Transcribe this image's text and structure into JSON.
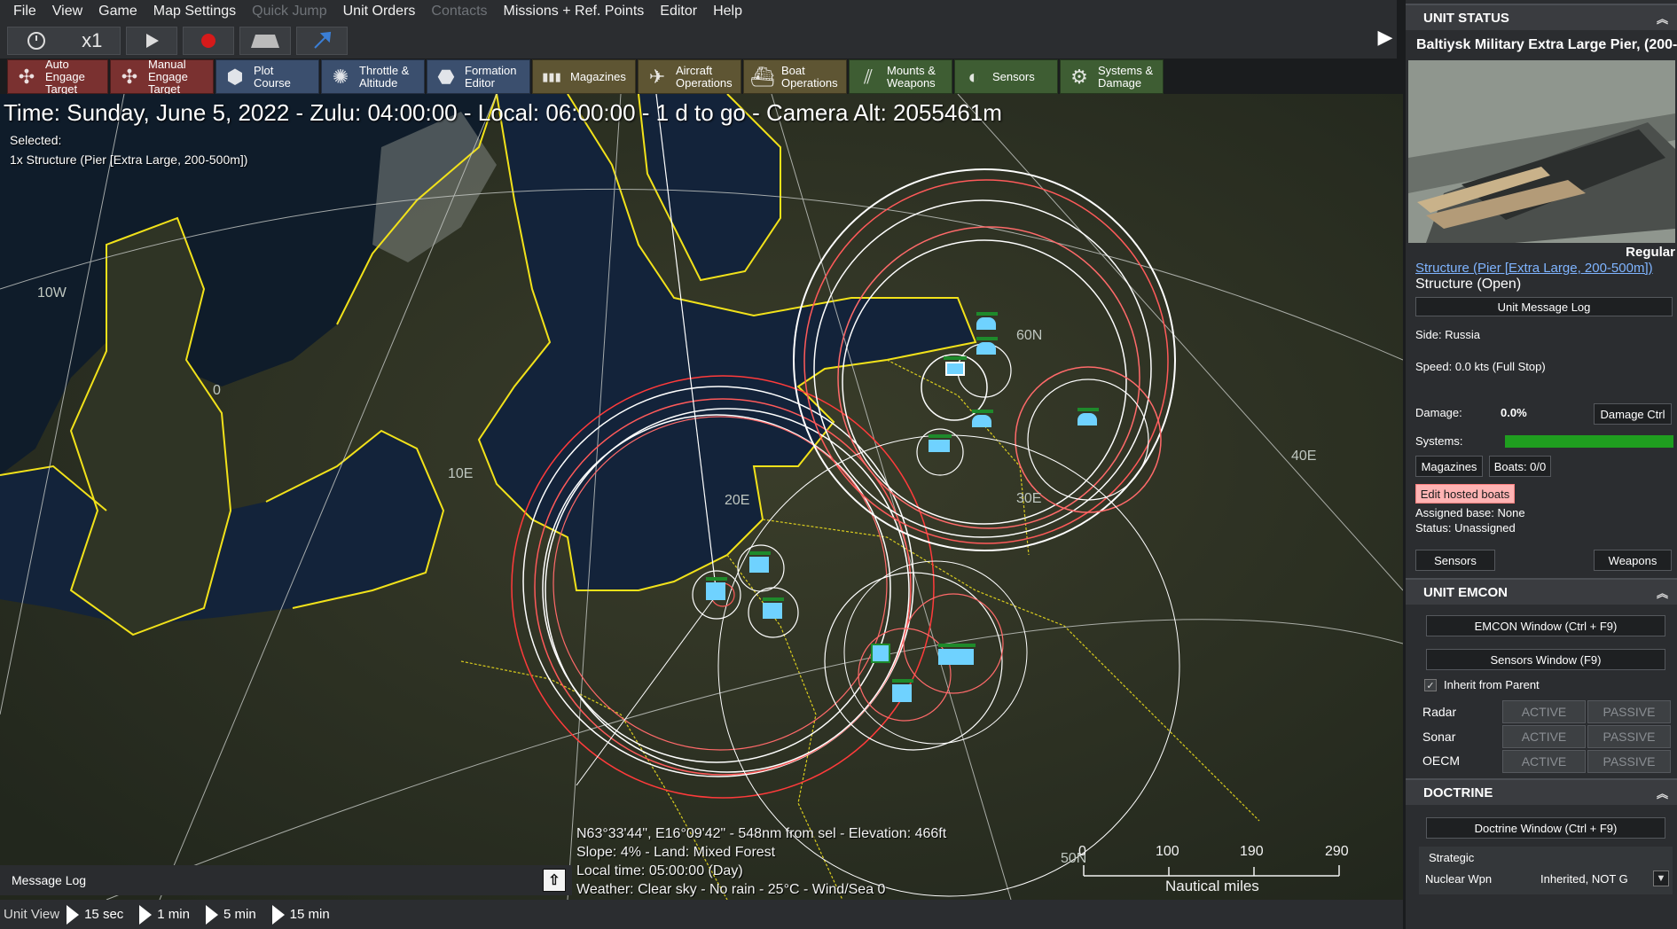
{
  "menu": [
    "File",
    "View",
    "Game",
    "Map Settings",
    "Quick Jump",
    "Unit Orders",
    "Contacts",
    "Missions + Ref. Points",
    "Editor",
    "Help"
  ],
  "menu_disabled": [
    "Quick Jump",
    "Contacts"
  ],
  "controls": {
    "speed": "x1",
    "icons": [
      "clock-icon",
      "play-icon",
      "record-icon",
      "hud-icon",
      "jump-icon"
    ]
  },
  "toolbar": [
    {
      "label": "Auto Engage\nTarget",
      "icon": "auto-engage-icon",
      "color": "#7a3130"
    },
    {
      "label": "Manual\nEngage Target",
      "icon": "manual-engage-icon",
      "color": "#7a3130"
    },
    {
      "label": "Plot Course",
      "icon": "plot-course-icon",
      "color": "#3b4f6e"
    },
    {
      "label": "Throttle &\nAltitude",
      "icon": "throttle-icon",
      "color": "#3b4f6e"
    },
    {
      "label": "Formation\nEditor",
      "icon": "formation-icon",
      "color": "#3b4f6e"
    },
    {
      "label": "Magazines",
      "icon": "magazines-icon",
      "color": "#5e5533"
    },
    {
      "label": "Aircraft\nOperations",
      "icon": "aircraft-icon",
      "color": "#5e5533"
    },
    {
      "label": "Boat\nOperations",
      "icon": "boat-icon",
      "color": "#5e5533"
    },
    {
      "label": "Mounts &\nWeapons",
      "icon": "mounts-icon",
      "color": "#3e5d33"
    },
    {
      "label": "Sensors",
      "icon": "sensors-icon",
      "color": "#3e5d33"
    },
    {
      "label": "Systems &\nDamage",
      "icon": "systems-icon",
      "color": "#3e5d33"
    }
  ],
  "map": {
    "time_line": "Time: Sunday, June 5, 2022 - Zulu: 04:00:00 - Local: 06:00:00 - 1 d to go -  Camera Alt: 2055461m",
    "selected_label": "Selected:",
    "selected_desc": "1x Structure (Pier [Extra Large, 200-500m])",
    "grid_labels": [
      "10W",
      "0",
      "10E",
      "20E",
      "60N",
      "30E",
      "40E",
      "50N"
    ],
    "cursor_info": [
      "N63°33'44\", E16°09'42\" - 548nm from sel - Elevation: 466ft",
      "Slope: 4% - Land: Mixed Forest",
      "Local time: 05:00:00 (Day)",
      "Weather: Clear sky - No rain - 25°C - Wind/Sea 0"
    ],
    "scale_ticks": [
      "0",
      "100",
      "190",
      "290"
    ],
    "scale_title": "Nautical miles"
  },
  "message_log": "Message Log",
  "bottom": {
    "unit_view": "Unit View",
    "steps": [
      "15 sec",
      "1 min",
      "5 min",
      "15 min"
    ]
  },
  "panel": {
    "status_title": "UNIT STATUS",
    "unit_name": "Baltiysk Military Extra Large Pier, (200-",
    "proficiency": "Regular",
    "class_link": "Structure (Pier [Extra Large, 200-500m])",
    "structure_state": "Structure (Open)",
    "message_log_btn": "Unit Message Log",
    "side": "Side: Russia",
    "speed": "Speed: 0.0 kts (Full Stop)",
    "damage_label": "Damage:",
    "damage_value": "0.0%",
    "damage_btn": "Damage Ctrl",
    "systems_label": "Systems:",
    "systems_health": 1.0,
    "systems_color": "#1f9e1f",
    "magazines_btn": "Magazines",
    "boats_btn": "Boats: 0/0",
    "edit_boats_btn": "Edit hosted boats",
    "assigned_base": "Assigned base: None",
    "status": "Status: Unassigned",
    "sensors_btn": "Sensors",
    "weapons_btn": "Weapons",
    "emcon_title": "UNIT EMCON",
    "emcon_window_btn": "EMCON Window (Ctrl + F9)",
    "sensors_window_btn": "Sensors Window (F9)",
    "inherit_label": "Inherit from Parent",
    "inherit_checked": true,
    "emcon_rows": [
      {
        "label": "Radar",
        "active": "ACTIVE",
        "passive": "PASSIVE"
      },
      {
        "label": "Sonar",
        "active": "ACTIVE",
        "passive": "PASSIVE"
      },
      {
        "label": "OECM",
        "active": "ACTIVE",
        "passive": "PASSIVE"
      }
    ],
    "doctrine_title": "DOCTRINE",
    "doctrine_window_btn": "Doctrine Window (Ctrl + F9)",
    "strategic_label": "Strategic",
    "nuclear_label": "Nuclear Wpn",
    "nuclear_value": "Inherited, NOT G"
  }
}
